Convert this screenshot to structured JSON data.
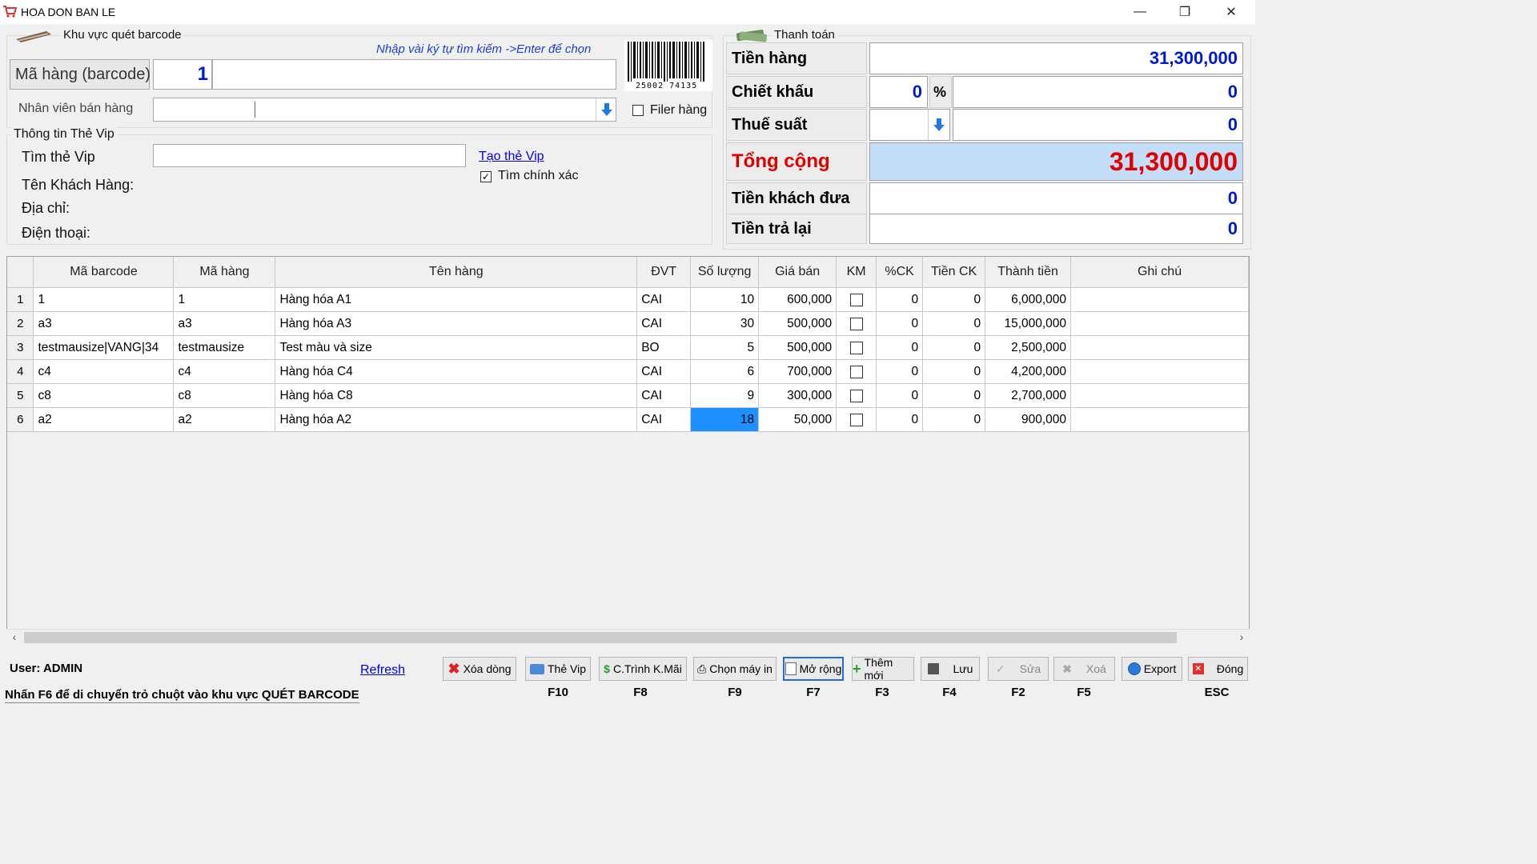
{
  "window": {
    "title": "HOA DON BAN LE"
  },
  "barcode": {
    "group_title": "Khu vực quét barcode",
    "hint": "Nhập vài ký tự tìm kiếm ->Enter để chọn",
    "label": "Mã hàng (barcode)",
    "code_value": "1",
    "barcode_number": "25002 74135",
    "staff_label": "Nhân viên bán hàng",
    "filter_label": "Filer hàng"
  },
  "vip": {
    "group_title": "Thông tin Thẻ Vip",
    "search_label": "Tìm thẻ Vip",
    "create_link": "Tạo thẻ Vip",
    "exact_label": "Tìm chính xác",
    "customer_label": "Tên Khách Hàng:",
    "address_label": "Địa chỉ:",
    "phone_label": "Điện thoại:"
  },
  "payment": {
    "group_title": "Thanh toán",
    "goods_label": "Tiền hàng",
    "goods_value": "31,300,000",
    "discount_label": "Chiết khấu",
    "discount_pct": "0",
    "pct_symbol": "%",
    "discount_value": "0",
    "tax_label": "Thuế suất",
    "tax_value": "0",
    "total_label": "Tổng cộng",
    "total_value": "31,300,000",
    "paid_label": "Tiền khách đưa",
    "paid_value": "0",
    "change_label": "Tiền trả lại",
    "change_value": "0"
  },
  "table": {
    "headers": [
      "Mã barcode",
      "Mã hàng",
      "Tên hàng",
      "ĐVT",
      "Số lượng",
      "Giá bán",
      "KM",
      "%CK",
      "Tiền CK",
      "Thành tiền",
      "Ghi chú"
    ],
    "rows": [
      {
        "n": "1",
        "barcode": "1",
        "code": "1",
        "name": "Hàng hóa A1",
        "unit": "CAI",
        "qty": "10",
        "price": "600,000",
        "pct": "0",
        "disc": "0",
        "amount": "6,000,000"
      },
      {
        "n": "2",
        "barcode": "a3",
        "code": "a3",
        "name": "Hàng hóa A3",
        "unit": "CAI",
        "qty": "30",
        "price": "500,000",
        "pct": "0",
        "disc": "0",
        "amount": "15,000,000"
      },
      {
        "n": "3",
        "barcode": "testmausize|VANG|34",
        "code": "testmausize",
        "name": "Test màu và size",
        "unit": "BO",
        "qty": "5",
        "price": "500,000",
        "pct": "0",
        "disc": "0",
        "amount": "2,500,000"
      },
      {
        "n": "4",
        "barcode": "c4",
        "code": "c4",
        "name": "Hàng hóa C4",
        "unit": "CAI",
        "qty": "6",
        "price": "700,000",
        "pct": "0",
        "disc": "0",
        "amount": "4,200,000"
      },
      {
        "n": "5",
        "barcode": "c8",
        "code": "c8",
        "name": "Hàng hóa C8",
        "unit": "CAI",
        "qty": "9",
        "price": "300,000",
        "pct": "0",
        "disc": "0",
        "amount": "2,700,000"
      },
      {
        "n": "6",
        "barcode": "a2",
        "code": "a2",
        "name": "Hàng hóa A2",
        "unit": "CAI",
        "qty": "18",
        "price": "50,000",
        "pct": "0",
        "disc": "0",
        "amount": "900,000"
      }
    ]
  },
  "footer": {
    "user": "User: ADMIN",
    "refresh": "Refresh",
    "status": "Nhấn F6 để di chuyển trỏ chuột vào khu vực QUÉT BARCODE"
  },
  "toolbar": {
    "delete_row": "Xóa dòng",
    "vip": "Thẻ Vip",
    "promo": "C.Trình K.Mãi",
    "printer": "Chọn máy in",
    "expand": "Mở rộng",
    "add": "Thêm mới",
    "save": "Lưu",
    "edit": "Sửa",
    "remove": "Xoá",
    "export": "Export",
    "close": "Đóng",
    "keys": {
      "vip": "F10",
      "promo": "F8",
      "printer": "F9",
      "expand": "F7",
      "add": "F3",
      "save": "F4",
      "edit": "F2",
      "remove": "F5",
      "close": "ESC"
    }
  },
  "colors": {
    "accent_blue": "#0018d8",
    "total_red": "#e00000",
    "total_bg": "#c5def7",
    "selected_cell": "#1e90ff"
  }
}
